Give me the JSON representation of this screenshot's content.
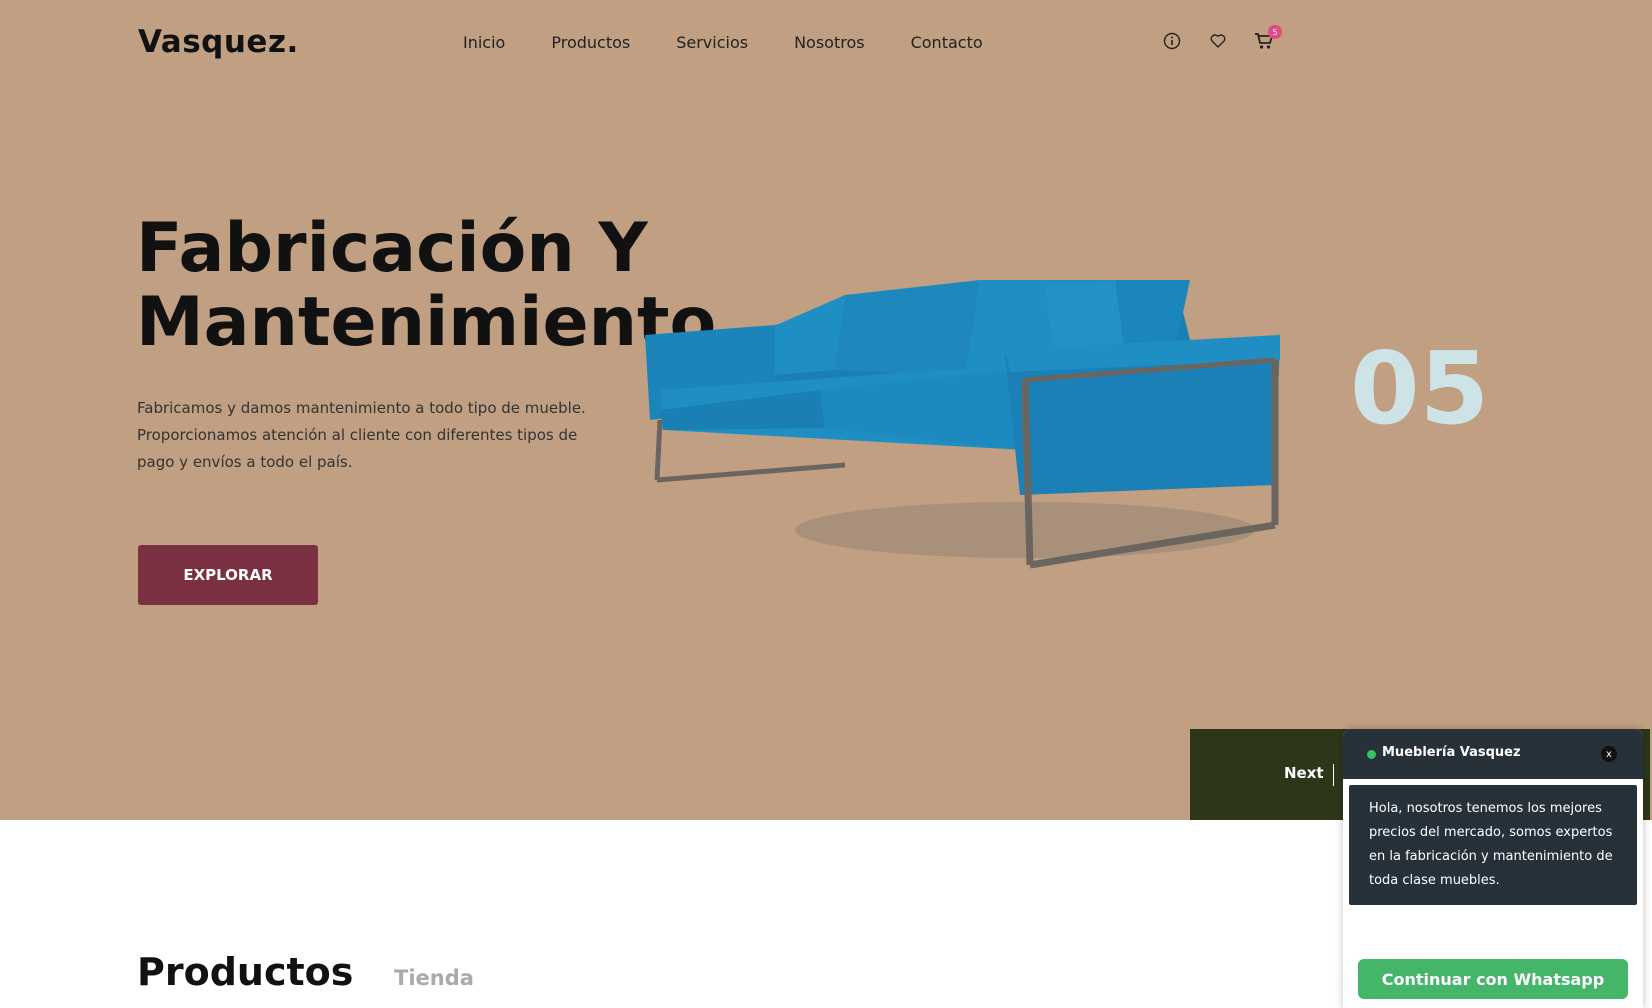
{
  "header": {
    "logo": "Vasquez.",
    "nav": [
      "Inicio",
      "Productos",
      "Servicios",
      "Nosotros",
      "Contacto"
    ],
    "icons": [
      "info-icon",
      "heart-icon",
      "cart-icon"
    ],
    "cart_count": "5"
  },
  "hero": {
    "title_line1": "Fabricación Y",
    "title_line2": "Mantenimiento",
    "description": "Fabricamos y damos mantenimiento a todo tipo de mueble. Proporcionamos atención al cliente con diferentes tipos de pago y envíos a todo el país.",
    "button": "EXPLORAR",
    "slide_number": "05",
    "next": "Next"
  },
  "products": {
    "title": "Productos",
    "tab": "Tienda"
  },
  "chat": {
    "name": "Mueblería Vasquez",
    "close": "x",
    "message": "Hola, nosotros tenemos los mejores precios del mercado, somos expertos en la fabricación y mantenimiento de toda clase muebles.",
    "button": "Continuar con Whatsapp"
  },
  "colors": {
    "hero_bg": "#c09f82",
    "button": "#7a3040",
    "sofa": "#1f8ec3",
    "next_bar": "#2d3619",
    "chat_header": "#27313a",
    "whatsapp": "#45b56a"
  }
}
